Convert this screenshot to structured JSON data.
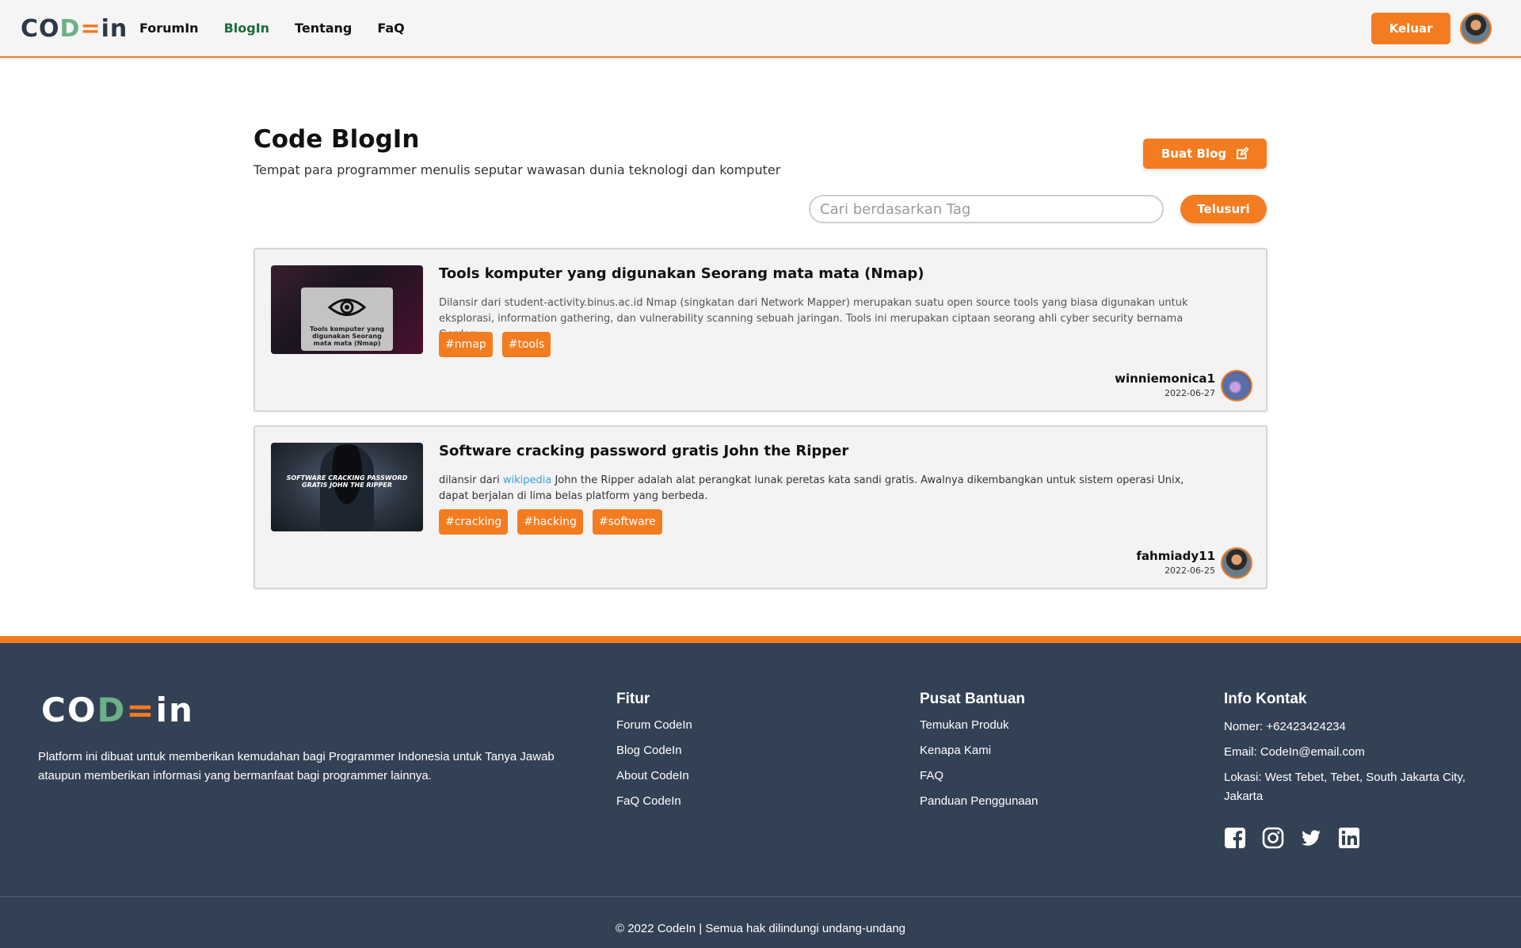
{
  "navbar": {
    "logo": {
      "a": "CO",
      "b": "D",
      "c": "=",
      "d": "in"
    },
    "links": [
      {
        "label": "ForumIn"
      },
      {
        "label": "BlogIn"
      },
      {
        "label": "Tentang"
      },
      {
        "label": "FaQ"
      }
    ],
    "active_link": "BlogIn",
    "logout_label": "Keluar"
  },
  "header": {
    "title": "Code BlogIn",
    "subtitle": "Tempat para programmer menulis seputar wawasan dunia teknologi dan komputer",
    "create_label": "Buat Blog",
    "search_placeholder": "Cari berdasarkan Tag",
    "search_label": "Telusuri"
  },
  "posts": [
    {
      "title": "Tools komputer yang digunakan Seorang mata mata (Nmap)",
      "desc": "Dilansir dari student-activity.binus.ac.id Nmap (singkatan dari Network Mapper) merupakan suatu open source tools yang biasa digunakan untuk eksplorasi, information gathering, dan vulnerability scanning sebuah jaringan. Tools ini merupakan ciptaan seorang ahli cyber security bernama Gordon",
      "thumb_caption": "Tools komputer yang digunakan Seorang mata mata (Nmap)",
      "tags": [
        "#nmap",
        "#tools"
      ],
      "author": "winniemonica1",
      "date": "2022-06-27"
    },
    {
      "title": "Software cracking password gratis John the Ripper",
      "desc_pre": "dilansir dari ",
      "desc_link": "wikipedia",
      "desc_post": " John the Ripper adalah alat perangkat lunak peretas kata sandi gratis. Awalnya dikembangkan untuk sistem operasi Unix, dapat berjalan di lima belas platform yang berbeda.",
      "thumb_caption": "SOFTWARE CRACKING PASSWORD GRATIS JOHN THE RIPPER",
      "tags": [
        "#cracking",
        "#hacking",
        "#software"
      ],
      "author": "fahmiady11",
      "date": "2022-06-25"
    }
  ],
  "footer": {
    "description": "Platform ini dibuat untuk memberikan kemudahan bagi Programmer Indonesia untuk Tanya Jawab ataupun memberikan informasi yang bermanfaat bagi programmer lainnya.",
    "fitur": {
      "title": "Fitur",
      "links": [
        "Forum CodeIn",
        "Blog CodeIn",
        "About CodeIn",
        "FaQ CodeIn"
      ]
    },
    "bantuan": {
      "title": "Pusat Bantuan",
      "links": [
        "Temukan Produk",
        "Kenapa Kami",
        "FAQ",
        "Panduan Penggunaan"
      ]
    },
    "kontak": {
      "title": "Info Kontak",
      "phone": "Nomer: +62423424234",
      "email": "Email: CodeIn@email.com",
      "location": "Lokasi: West Tebet, Tebet, South Jakarta City, Jakarta"
    },
    "socials": [
      "facebook-icon",
      "instagram-icon",
      "twitter-icon",
      "linkedin-icon"
    ],
    "copyright": "© 2022 CodeIn | Semua hak dilindungi undang-undang"
  },
  "colors": {
    "accent": "#f47c20",
    "footer_bg": "#334155",
    "active_link": "#1e6b3a",
    "logo_green": "#6ab187",
    "link_blue": "#3aa0d6"
  }
}
